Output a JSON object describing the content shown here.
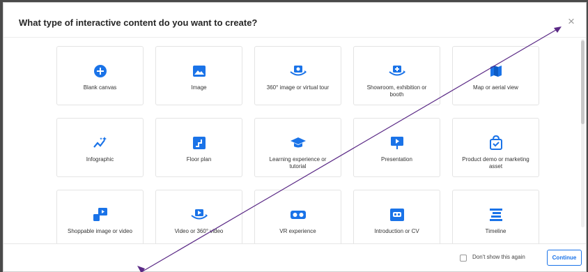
{
  "modal": {
    "title": "What type of interactive content do you want to create?",
    "close_symbol": "×"
  },
  "cards": [
    {
      "label": "Blank canvas",
      "icon": "plus-circle-icon"
    },
    {
      "label": "Image",
      "icon": "image-icon"
    },
    {
      "label": "360° image or virtual tour",
      "icon": "360-image-icon"
    },
    {
      "label": "Showroom, exhibition or booth",
      "icon": "showroom-icon"
    },
    {
      "label": "Map or aerial view",
      "icon": "map-icon"
    },
    {
      "label": "Infographic",
      "icon": "infographic-icon"
    },
    {
      "label": "Floor plan",
      "icon": "floor-plan-icon"
    },
    {
      "label": "Learning experience or tutorial",
      "icon": "graduation-cap-icon"
    },
    {
      "label": "Presentation",
      "icon": "presentation-icon"
    },
    {
      "label": "Product demo or marketing asset",
      "icon": "shopping-bag-icon"
    },
    {
      "label": "Shoppable image or video",
      "icon": "shoppable-video-icon"
    },
    {
      "label": "Video or 360° video",
      "icon": "360-video-icon"
    },
    {
      "label": "VR experience",
      "icon": "vr-headset-icon"
    },
    {
      "label": "Introduction or CV",
      "icon": "vr-frame-icon"
    },
    {
      "label": "Timeline",
      "icon": "timeline-icon"
    }
  ],
  "footer": {
    "dont_show_label": "Don't show this again",
    "dont_show_checked": false,
    "continue_label": "Continue"
  },
  "colors": {
    "accent": "#1a73e8",
    "arrow": "#5b2a86"
  }
}
